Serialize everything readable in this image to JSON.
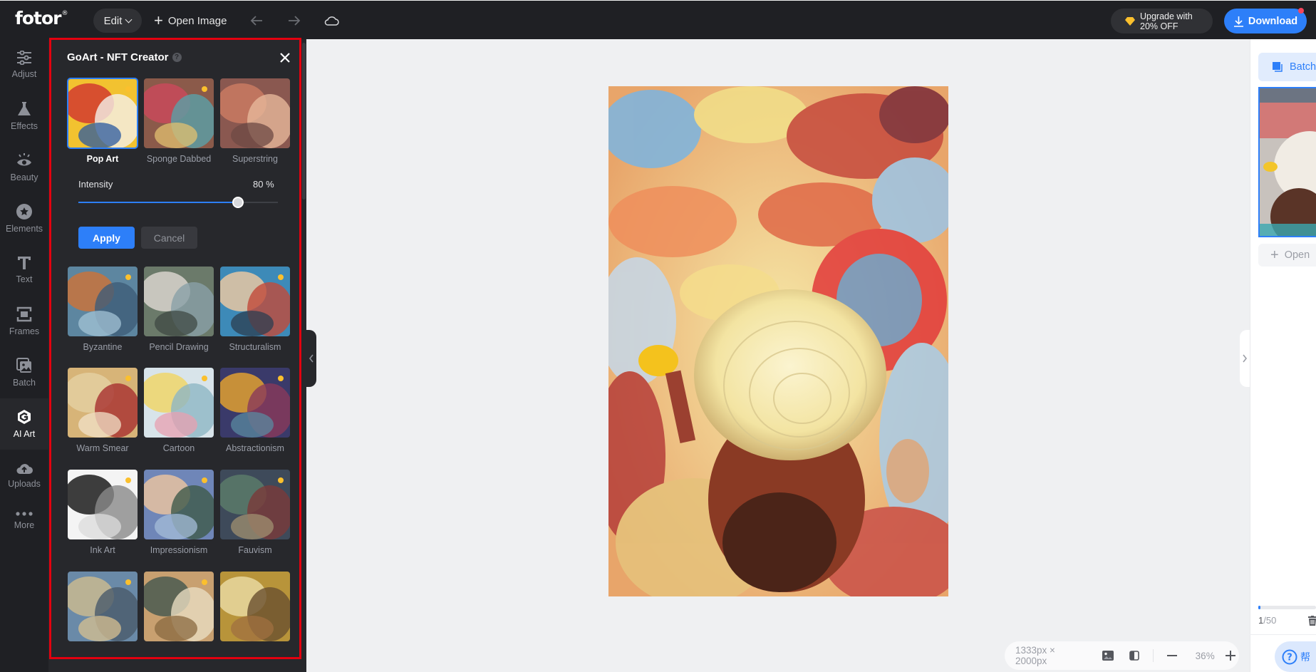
{
  "topbar": {
    "logo": "fotor",
    "logo_mark": "®",
    "edit_label": "Edit",
    "open_image_label": "Open Image",
    "icons": [
      "undo-arrow-icon",
      "redo-arrow-icon",
      "cloud-icon"
    ],
    "upgrade_line1": "Upgrade with",
    "upgrade_line2": "20% OFF",
    "download_label": "Download"
  },
  "sidebar": {
    "items": [
      {
        "label": "Adjust",
        "icon": "sliders-icon"
      },
      {
        "label": "Effects",
        "icon": "flask-icon"
      },
      {
        "label": "Beauty",
        "icon": "eye-icon"
      },
      {
        "label": "Elements",
        "icon": "star-circle-icon"
      },
      {
        "label": "Text",
        "icon": "text-t-icon"
      },
      {
        "label": "Frames",
        "icon": "frame-icon"
      },
      {
        "label": "Batch",
        "icon": "images-stack-icon"
      },
      {
        "label": "AI Art",
        "icon": "goart-logo-icon",
        "active": true
      },
      {
        "label": "Uploads",
        "icon": "cloud-upload-icon"
      },
      {
        "label": "More",
        "icon": "more-dots-icon"
      }
    ]
  },
  "panel": {
    "title": "GoArt - NFT Creator",
    "help": "?",
    "styles": [
      {
        "label": "Pop Art",
        "selected": true,
        "premium": true
      },
      {
        "label": "Sponge Dabbed",
        "premium": true
      },
      {
        "label": "Superstring",
        "premium": false
      },
      {
        "label": "Byzantine",
        "premium": true
      },
      {
        "label": "Pencil Drawing",
        "premium": false
      },
      {
        "label": "Structuralism",
        "premium": true
      },
      {
        "label": "Warm Smear",
        "premium": true
      },
      {
        "label": "Cartoon",
        "premium": true
      },
      {
        "label": "Abstractionism",
        "premium": true
      },
      {
        "label": "Ink Art",
        "premium": true
      },
      {
        "label": "Impressionism",
        "premium": true
      },
      {
        "label": "Fauvism",
        "premium": true
      },
      {
        "label": "",
        "premium": true
      },
      {
        "label": "",
        "premium": true
      },
      {
        "label": "",
        "premium": false
      }
    ],
    "intensity_label": "Intensity",
    "intensity_value": 80,
    "intensity_display": "80 %",
    "apply_label": "Apply",
    "cancel_label": "Cancel"
  },
  "canvas": {
    "dimensions": "1333px × 2000px",
    "zoom": "36%"
  },
  "right_panel": {
    "batch_label": "Batch",
    "open_label": "Open",
    "progress_fraction": 0.02,
    "count_current": "1",
    "count_total": "/50",
    "help_label": "帮"
  }
}
